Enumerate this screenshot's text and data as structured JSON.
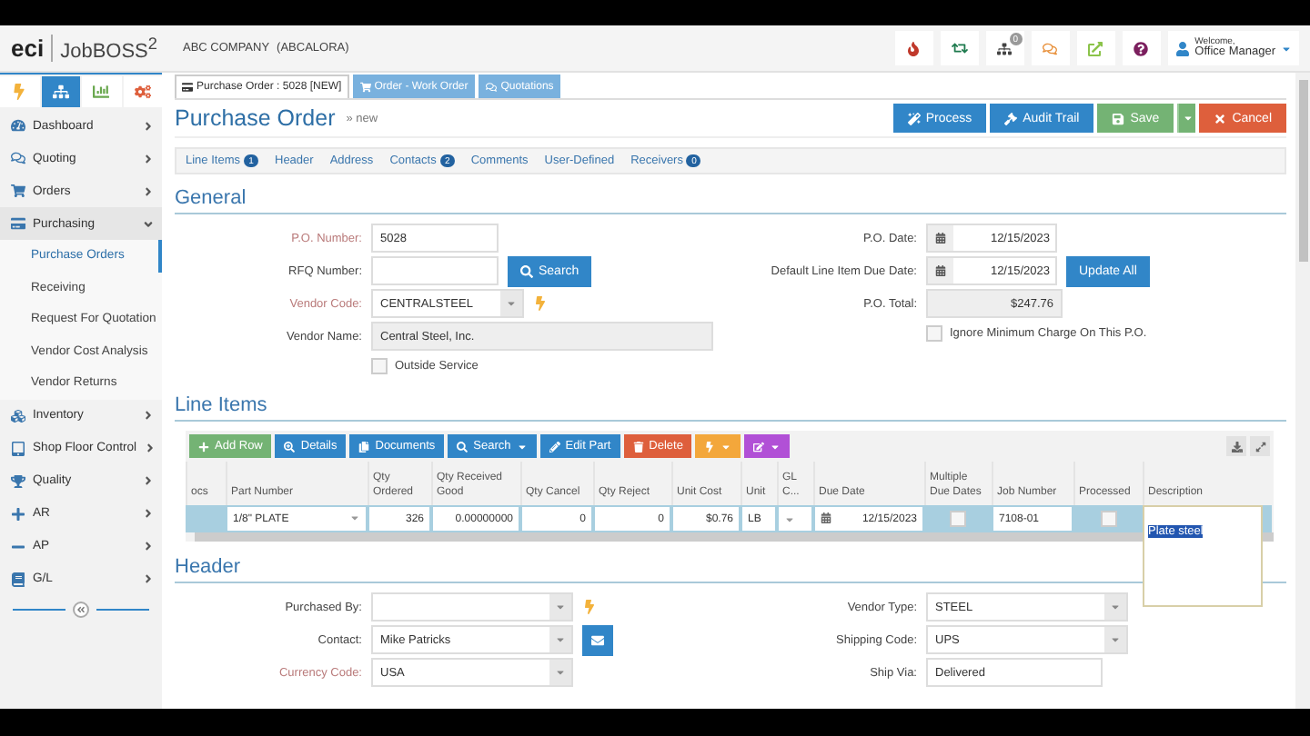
{
  "topbar": {
    "logo_mark": "eci",
    "logo_name": "JobBOSS$^{2}$",
    "company": "ABC COMPANY",
    "company_code": "(ABCALORA)",
    "notification_count": "0",
    "welcome": "Welcome,",
    "user": "Office Manager"
  },
  "sidebar": {
    "modules": [
      {
        "selected": false
      },
      {
        "selected": true
      },
      {
        "selected": false
      },
      {
        "selected": false
      }
    ],
    "items": [
      {
        "label": "Dashboard",
        "expanded": false
      },
      {
        "label": "Quoting",
        "expanded": false
      },
      {
        "label": "Orders",
        "expanded": false
      },
      {
        "label": "Purchasing",
        "expanded": true,
        "children": [
          {
            "label": "Purchase Orders",
            "selected": true
          },
          {
            "label": "Receiving",
            "selected": false
          },
          {
            "label": "Request For Quotation",
            "selected": false
          },
          {
            "label": "Vendor Cost Analysis",
            "selected": false
          },
          {
            "label": "Vendor Returns",
            "selected": false
          }
        ]
      },
      {
        "label": "Inventory",
        "expanded": false
      },
      {
        "label": "Shop Floor Control",
        "expanded": false
      },
      {
        "label": "Quality",
        "expanded": false
      },
      {
        "label": "AR",
        "expanded": false
      },
      {
        "label": "AP",
        "expanded": false
      },
      {
        "label": "G/L",
        "expanded": false
      }
    ]
  },
  "doc_tabs": [
    {
      "label": "Purchase Order : 5028 [NEW]",
      "selected": true
    },
    {
      "label": "Order - Work Order",
      "selected": false
    },
    {
      "label": "Quotations",
      "selected": false
    }
  ],
  "page": {
    "title": "Purchase Order",
    "subtitle": "» new"
  },
  "actions": [
    {
      "label": "Process",
      "kind": "primary"
    },
    {
      "label": "Audit Trail",
      "kind": "primary"
    },
    {
      "label": "Save",
      "kind": "success"
    },
    {
      "label": "Cancel",
      "kind": "danger"
    }
  ],
  "section_tabs": [
    {
      "label": "Line Items",
      "badge": "1"
    },
    {
      "label": "Header"
    },
    {
      "label": "Address"
    },
    {
      "label": "Contacts",
      "badge": "2"
    },
    {
      "label": "Comments"
    },
    {
      "label": "User-Defined"
    },
    {
      "label": "Receivers",
      "badge": "0"
    }
  ],
  "general": {
    "title": "General",
    "left": [
      {
        "label": "P.O. Number:",
        "kind": "text",
        "value": "5028",
        "required": true
      },
      {
        "label": "RFQ Number:",
        "kind": "text",
        "required": false,
        "button": "Search"
      },
      {
        "label": "Vendor Code:",
        "kind": "select",
        "value": "CENTRALSTEEL",
        "required": true,
        "quick_add": true
      },
      {
        "label": "Vendor Name:",
        "kind": "readonly",
        "value": "Central Steel, Inc.",
        "required": false
      },
      {
        "label": "Outside Service",
        "kind": "checkbox",
        "checked": false
      }
    ],
    "right": [
      {
        "label": "P.O. Date:",
        "kind": "date",
        "value": "12/15/2023",
        "required": false
      },
      {
        "label": "Default Line Item Due Date:",
        "kind": "date",
        "value": "12/15/2023",
        "required": false,
        "button": "Update All"
      },
      {
        "label": "P.O. Total:",
        "kind": "readonly",
        "value": "$247.76",
        "required": false
      },
      {
        "label": "Ignore Minimum Charge On This P.O.",
        "kind": "checkbox",
        "checked": false
      }
    ]
  },
  "line_items": {
    "title": "Line Items",
    "toolbar": [
      {
        "label": "Add Row",
        "kind": "success"
      },
      {
        "label": "Details",
        "kind": "primary"
      },
      {
        "label": "Documents",
        "kind": "primary"
      },
      {
        "label": "Search",
        "kind": "primary",
        "dropdown": true
      },
      {
        "label": "Edit Part",
        "kind": "primary"
      },
      {
        "label": "Delete",
        "kind": "danger"
      },
      {
        "kind": "warning",
        "dropdown": true
      },
      {
        "kind": "purple",
        "dropdown": true
      }
    ],
    "columns": [
      "ocs",
      "Part Number",
      "Qty Ordered",
      "Qty Received Good",
      "Qty Cancel",
      "Qty Reject",
      "Unit Cost",
      "Unit",
      "GL C...",
      "Due Date",
      "Multiple Due Dates",
      "Job Number",
      "Processed",
      "Description"
    ],
    "rows": [
      {
        "selected": true,
        "part_number": "1/8\" PLATE",
        "qty_ordered": "326",
        "qty_received_good": "0.00000000",
        "qty_cancel": "0",
        "qty_reject": "0",
        "unit_cost": "$0.76",
        "unit": "LB",
        "due_date": "12/15/2023",
        "multiple_due_dates": false,
        "job_number": "7108-01",
        "processed": false,
        "description": "Plate steel",
        "editing_description": true
      }
    ]
  },
  "header": {
    "title": "Header",
    "left": [
      {
        "label": "Purchased By:",
        "kind": "select",
        "required": false,
        "quick_add": true
      },
      {
        "label": "Contact:",
        "kind": "select",
        "value": "Mike Patricks",
        "required": false,
        "email": true
      },
      {
        "label": "Currency Code:",
        "kind": "select",
        "value": "USA",
        "required": true
      }
    ],
    "right": [
      {
        "label": "Vendor Type:",
        "kind": "select",
        "value": "STEEL",
        "required": false
      },
      {
        "label": "Shipping Code:",
        "kind": "select",
        "value": "UPS",
        "required": false
      },
      {
        "label": "Ship Via:",
        "kind": "text",
        "value": "Delivered",
        "required": false
      }
    ]
  }
}
